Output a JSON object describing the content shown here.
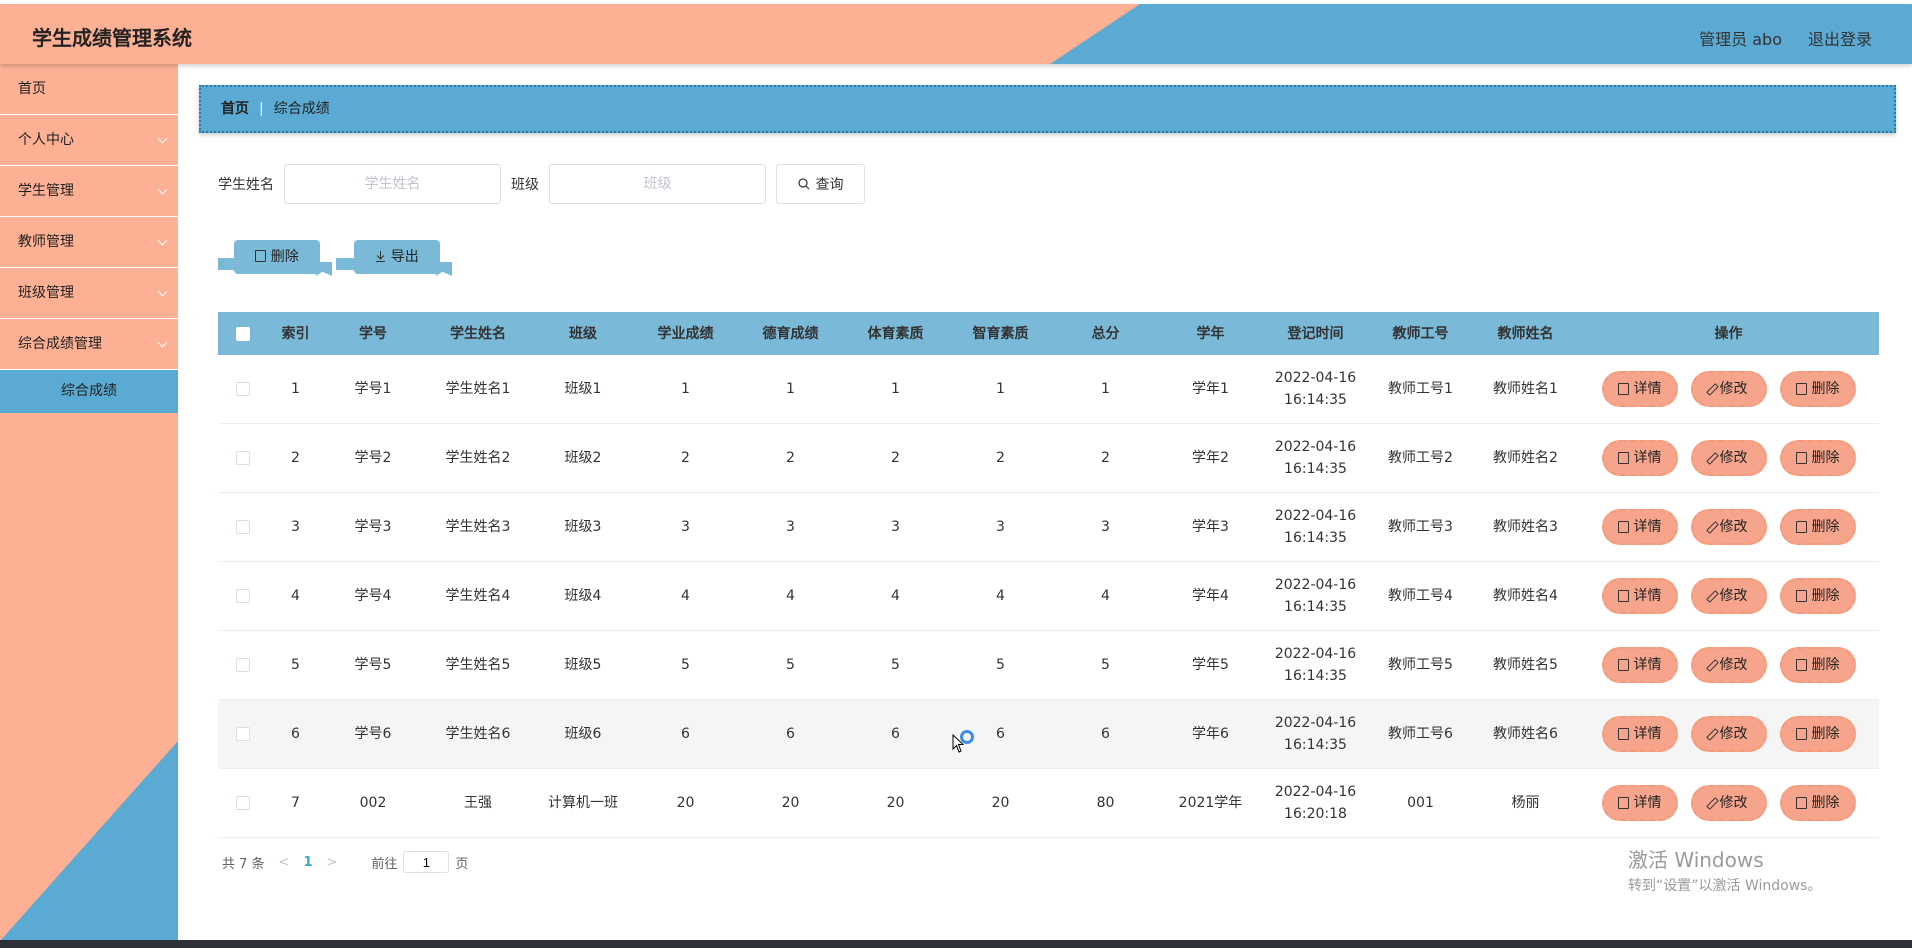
{
  "header": {
    "title": "学生成绩管理系统",
    "admin": "管理员 abo",
    "logout": "退出登录"
  },
  "sidebar": {
    "items": [
      {
        "label": "首页"
      },
      {
        "label": "个人中心"
      },
      {
        "label": "学生管理"
      },
      {
        "label": "教师管理"
      },
      {
        "label": "班级管理"
      },
      {
        "label": "综合成绩管理"
      }
    ],
    "active_sub": "综合成绩"
  },
  "breadcrumb": {
    "home": "首页",
    "separator": "|",
    "current": "综合成绩"
  },
  "search": {
    "student_label": "学生姓名",
    "student_placeholder": "学生姓名",
    "class_label": "班级",
    "class_placeholder": "班级",
    "query_label": "查询"
  },
  "actions": {
    "delete_label": "删除",
    "export_label": "导出"
  },
  "table": {
    "headers": [
      "索引",
      "学号",
      "学生姓名",
      "班级",
      "学业成绩",
      "德育成绩",
      "体育素质",
      "智育素质",
      "总分",
      "学年",
      "登记时间",
      "教师工号",
      "教师姓名",
      "操作"
    ],
    "op_labels": {
      "detail": "详情",
      "edit": "修改",
      "delete": "删除"
    },
    "rows": [
      [
        "1",
        "学号1",
        "学生姓名1",
        "班级1",
        "1",
        "1",
        "1",
        "1",
        "1",
        "学年1",
        "2022-04-16",
        "16:14:35",
        "教师工号1",
        "教师姓名1"
      ],
      [
        "2",
        "学号2",
        "学生姓名2",
        "班级2",
        "2",
        "2",
        "2",
        "2",
        "2",
        "学年2",
        "2022-04-16",
        "16:14:35",
        "教师工号2",
        "教师姓名2"
      ],
      [
        "3",
        "学号3",
        "学生姓名3",
        "班级3",
        "3",
        "3",
        "3",
        "3",
        "3",
        "学年3",
        "2022-04-16",
        "16:14:35",
        "教师工号3",
        "教师姓名3"
      ],
      [
        "4",
        "学号4",
        "学生姓名4",
        "班级4",
        "4",
        "4",
        "4",
        "4",
        "4",
        "学年4",
        "2022-04-16",
        "16:14:35",
        "教师工号4",
        "教师姓名4"
      ],
      [
        "5",
        "学号5",
        "学生姓名5",
        "班级5",
        "5",
        "5",
        "5",
        "5",
        "5",
        "学年5",
        "2022-04-16",
        "16:14:35",
        "教师工号5",
        "教师姓名5"
      ],
      [
        "6",
        "学号6",
        "学生姓名6",
        "班级6",
        "6",
        "6",
        "6",
        "6",
        "6",
        "学年6",
        "2022-04-16",
        "16:14:35",
        "教师工号6",
        "教师姓名6"
      ],
      [
        "7",
        "002",
        "王强",
        "计算机一班",
        "20",
        "20",
        "20",
        "20",
        "80",
        "2021学年",
        "2022-04-16",
        "16:20:18",
        "001",
        "杨丽"
      ]
    ]
  },
  "pager": {
    "total": "共 7 条",
    "prev": "<",
    "current": "1",
    "next": ">",
    "goto_prefix": "前往",
    "goto_value": "1",
    "goto_suffix": "页"
  },
  "watermark": {
    "line1": "激活 Windows",
    "line2": "转到“设置”以激活 Windows。"
  }
}
